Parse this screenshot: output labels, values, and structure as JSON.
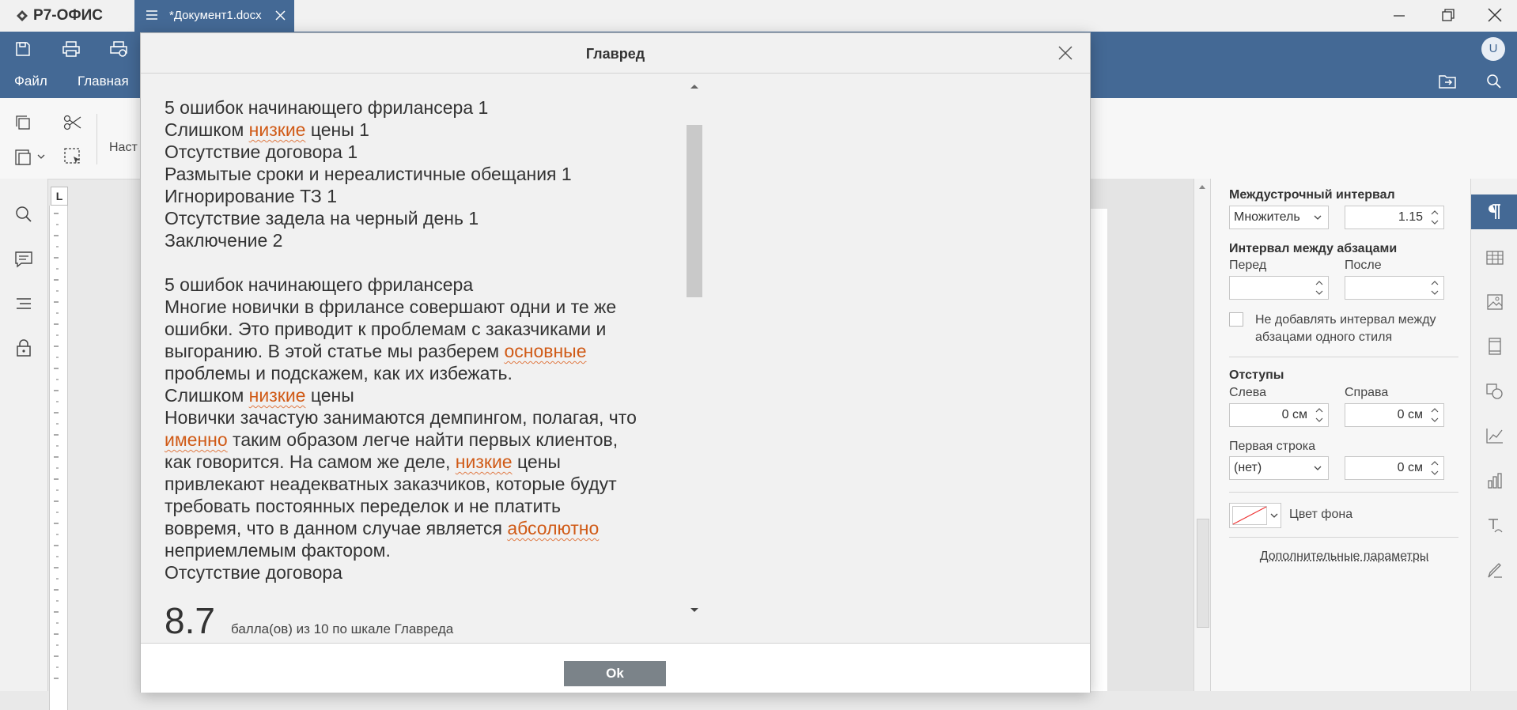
{
  "app": {
    "name": "Р7-ОФИС"
  },
  "tab": {
    "title": "*Документ1.docx"
  },
  "avatar": "U",
  "menu": {
    "file": "Файл",
    "home": "Главная"
  },
  "ribbon": {
    "partial_label": "Наст"
  },
  "right_panel": {
    "line_spacing_title": "Междустрочный интервал",
    "line_spacing_mode": "Множитель",
    "line_spacing_value": "1.15",
    "para_spacing_title": "Интервал между абзацами",
    "before_label": "Перед",
    "after_label": "После",
    "no_interval_label_1": "Не добавлять интервал между",
    "no_interval_label_2": "абзацами одного стиля",
    "indents_title": "Отступы",
    "left_label": "Слева",
    "right_label": "Справа",
    "left_value": "0 см",
    "right_value": "0 см",
    "first_line_label": "Первая строка",
    "first_line_mode": "(нет)",
    "first_line_value": "0 см",
    "bg_color_label": "Цвет фона",
    "advanced_link": "Дополнительные параметры"
  },
  "dialog": {
    "title": "Главред",
    "lines": [
      [
        {
          "t": "5 ошибок начинающего фрилансера 1"
        }
      ],
      [
        {
          "t": "Слишком "
        },
        {
          "t": "низкие",
          "hl": true
        },
        {
          "t": " цены 1"
        }
      ],
      [
        {
          "t": "Отсутствие договора 1"
        }
      ],
      [
        {
          "t": "Размытые сроки и нереалистичные обещания 1"
        }
      ],
      [
        {
          "t": "Игнорирование ТЗ 1"
        }
      ],
      [
        {
          "t": "Отсутствие задела на черный день 1"
        }
      ],
      [
        {
          "t": "Заключение 2"
        }
      ],
      [
        {
          "t": ""
        }
      ],
      [
        {
          "t": "5 ошибок начинающего фрилансера"
        }
      ],
      [
        {
          "t": "Многие новички в фрилансе совершают одни и те же"
        }
      ],
      [
        {
          "t": "ошибки. Это приводит к проблемам с заказчиками и"
        }
      ],
      [
        {
          "t": "выгоранию. В этой статье мы разберем "
        },
        {
          "t": "основные",
          "hl": true
        }
      ],
      [
        {
          "t": "проблемы и подскажем, как их избежать."
        }
      ],
      [
        {
          "t": "Слишком "
        },
        {
          "t": "низкие",
          "hl": true
        },
        {
          "t": " цены"
        }
      ],
      [
        {
          "t": "Новички зачастую занимаются демпингом, полагая, что"
        }
      ],
      [
        {
          "t": "именно",
          "hl": true
        },
        {
          "t": " таким образом легче найти первых клиентов,"
        }
      ],
      [
        {
          "t": "как говорится. На самом же деле, "
        },
        {
          "t": "низкие",
          "hl": true
        },
        {
          "t": " цены"
        }
      ],
      [
        {
          "t": "привлекают неадекватных заказчиков, которые будут"
        }
      ],
      [
        {
          "t": "требовать постоянных переделок и не платить"
        }
      ],
      [
        {
          "t": "вовремя, что в данном случае является "
        },
        {
          "t": "абсолютно",
          "hl": true
        }
      ],
      [
        {
          "t": "неприемлемым фактором."
        }
      ],
      [
        {
          "t": "Отсутствие договора"
        }
      ]
    ],
    "score_value": "8.7",
    "score_text": "балла(ов) из 10 по шкале Главреда",
    "ok_label": "Ok"
  },
  "colors": {
    "accent": "#446995",
    "highlight": "#d05a16",
    "ok_button": "#7b8389"
  }
}
